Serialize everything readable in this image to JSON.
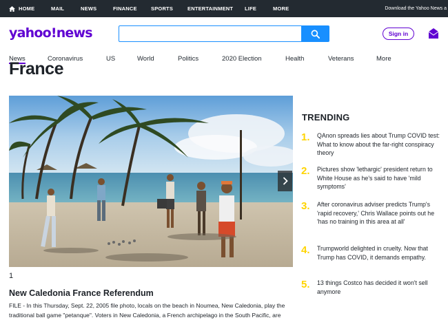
{
  "topbar": {
    "items": [
      "HOME",
      "MAIL",
      "NEWS",
      "FINANCE",
      "SPORTS",
      "ENTERTAINMENT",
      "LIFE",
      "MORE"
    ],
    "right_text": "Download the Yahoo News a"
  },
  "header": {
    "logo": "yahoo!news",
    "search_placeholder": "",
    "signin_label": "Sign in"
  },
  "secnav": {
    "items": [
      "News",
      "Coronavirus",
      "US",
      "World",
      "Politics",
      "2020 Election",
      "Health",
      "Veterans",
      "More"
    ]
  },
  "page_title": "France",
  "slideshow": {
    "counter": "1",
    "title": "New Caledonia France Referendum",
    "caption": "FILE - In this Thursday, Sept. 22, 2005 file photo, locals on the beach in Noumea, New Caledonia, play the traditional ball game \"petanque\". Voters in New Caledonia, a French archipelago in the South Pacific, are"
  },
  "trending": {
    "title": "TRENDING",
    "items": [
      {
        "num": "1.",
        "text": "QAnon spreads lies about Trump COVID test: What to know about the far-right conspiracy theory"
      },
      {
        "num": "2.",
        "text": "Pictures show 'lethargic' president return to White House as he's said to have 'mild symptoms'"
      },
      {
        "num": "3.",
        "text": "After coronavirus adviser predicts Trump's 'rapid recovery,' Chris Wallace points out he 'has no training in this area at all'"
      },
      {
        "num": "4.",
        "text": "Trumpworld delighted in cruelty. Now that Trump has COVID, it demands empathy."
      },
      {
        "num": "5.",
        "text": "13 things Costco has decided it won't sell anymore"
      }
    ]
  },
  "colors": {
    "brand_purple": "#6001d2",
    "search_blue": "#188fff",
    "trending_yellow": "#ffd400",
    "topbar_bg": "#232a31"
  }
}
